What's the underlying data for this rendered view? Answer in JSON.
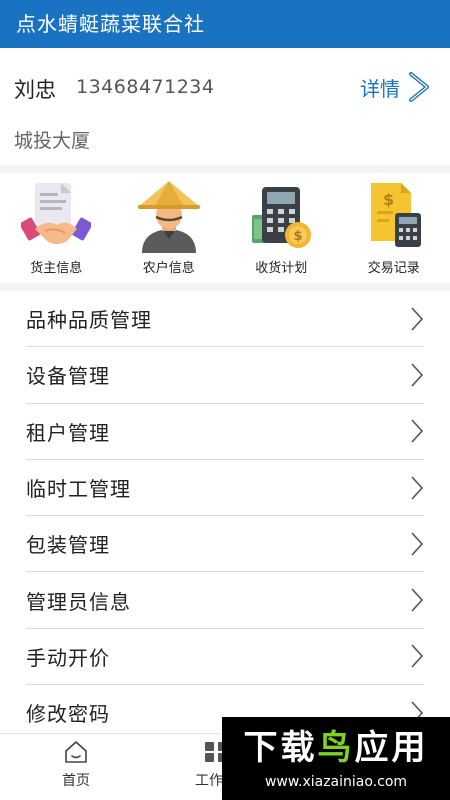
{
  "header": {
    "title": "点水蜻蜓蔬菜联合社"
  },
  "user": {
    "name": "刘忠",
    "phone": "13468471234",
    "detail_label": "详情",
    "address": "城投大厦"
  },
  "quick_actions": [
    {
      "label": "货主信息",
      "icon": "handshake-document-icon"
    },
    {
      "label": "农户信息",
      "icon": "farmer-icon"
    },
    {
      "label": "收货计划",
      "icon": "calculator-coin-icon"
    },
    {
      "label": "交易记录",
      "icon": "bill-calculator-icon"
    }
  ],
  "menu": [
    {
      "label": "品种品质管理"
    },
    {
      "label": "设备管理"
    },
    {
      "label": "租户管理"
    },
    {
      "label": "临时工管理"
    },
    {
      "label": "包装管理"
    },
    {
      "label": "管理员信息"
    },
    {
      "label": "手动开价"
    },
    {
      "label": "修改密码"
    }
  ],
  "tabs": [
    {
      "label": "首页",
      "icon": "home-icon"
    },
    {
      "label": "工作台",
      "icon": "grid-icon"
    }
  ],
  "watermark": {
    "title_part1": "下载",
    "title_part2": "鸟",
    "title_part3": "应用",
    "url": "www.xiazainiao.com"
  },
  "colors": {
    "primary": "#1a73c2",
    "divider": "#dcdcdc",
    "section_bg": "#f4f4f4"
  }
}
